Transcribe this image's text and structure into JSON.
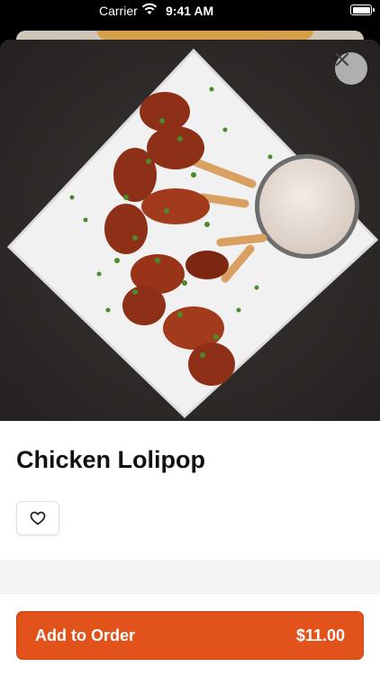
{
  "status_bar": {
    "carrier": "Carrier",
    "time": "9:41 AM"
  },
  "item": {
    "title": "Chicken Lolipop"
  },
  "order_button": {
    "label": "Add to Order",
    "price": "$11.00"
  },
  "icons": {
    "close": "close-icon",
    "favorite": "heart-outline-icon",
    "wifi": "wifi-icon",
    "battery": "battery-icon"
  },
  "colors": {
    "accent": "#e2531c",
    "close_button_bg": "#c8c8c8"
  }
}
